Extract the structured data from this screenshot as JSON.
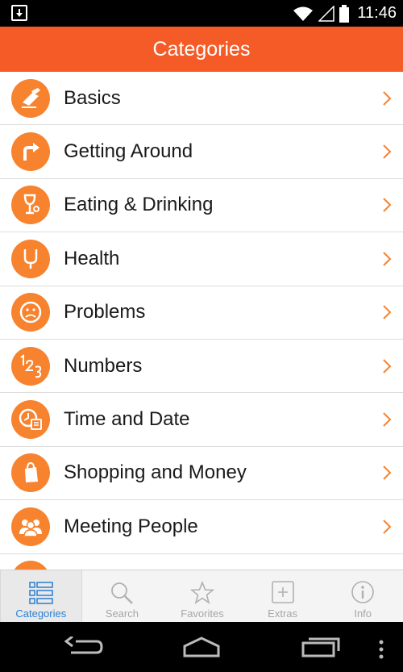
{
  "status_bar": {
    "time": "11:46"
  },
  "header": {
    "title": "Categories"
  },
  "categories": [
    {
      "label": "Basics",
      "icon": "pencil-paper-icon"
    },
    {
      "label": "Getting Around",
      "icon": "turn-arrow-icon"
    },
    {
      "label": "Eating & Drinking",
      "icon": "wine-glass-icon"
    },
    {
      "label": "Health",
      "icon": "stethoscope-icon"
    },
    {
      "label": "Problems",
      "icon": "sad-face-icon"
    },
    {
      "label": "Numbers",
      "icon": "numbers-123-icon"
    },
    {
      "label": "Time and Date",
      "icon": "clock-calendar-icon"
    },
    {
      "label": "Shopping and Money",
      "icon": "shopping-bag-icon"
    },
    {
      "label": "Meeting People",
      "icon": "people-group-icon"
    }
  ],
  "tabs": [
    {
      "label": "Categories",
      "icon": "list-icon",
      "active": true
    },
    {
      "label": "Search",
      "icon": "magnifier-icon",
      "active": false
    },
    {
      "label": "Favorites",
      "icon": "star-icon",
      "active": false
    },
    {
      "label": "Extras",
      "icon": "plus-box-icon",
      "active": false
    },
    {
      "label": "Info",
      "icon": "info-icon",
      "active": false
    }
  ],
  "colors": {
    "accent": "#f45b27",
    "icon_bg": "#f7832f",
    "tab_active": "#2a7fd4"
  }
}
